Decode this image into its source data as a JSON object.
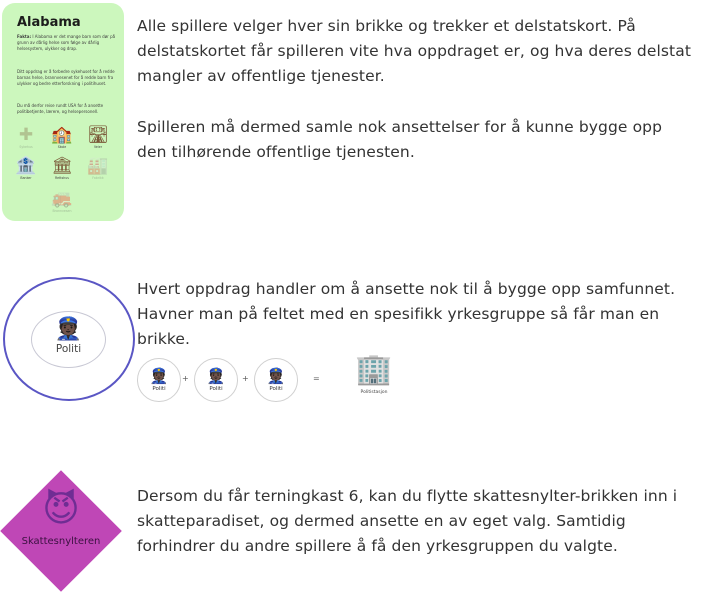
{
  "section1": {
    "card": {
      "title": "Alabama",
      "fact_label": "Fakta:",
      "fact_text": "I Alabama er det mange barn som dør på grunn av dårlig helse som følge av dårlig helsesystem, ulykker og drap.",
      "mission_text": "Ditt oppdrag er å forbedre sykehuset for å redde barnas helse, brannvesenet for å redde barn fra ulykker og bedre etterforskning i politihuset.",
      "travel_text": "Du må derfor reise rundt USA for å ansette politibetjente, lærere, og helsepersonell.",
      "services": [
        {
          "icon": "hospital-icon",
          "glyph": "✚",
          "label": "Sykehus",
          "missing": true
        },
        {
          "icon": "school-icon",
          "glyph": "🏫",
          "label": "Skole",
          "missing": false
        },
        {
          "icon": "road-icon",
          "glyph": "🛣",
          "label": "Veier",
          "missing": false
        },
        {
          "icon": "bank-icon",
          "glyph": "🏦",
          "label": "Banker",
          "missing": false
        },
        {
          "icon": "courthouse-icon",
          "glyph": "🏛",
          "label": "Rettshus",
          "missing": false
        },
        {
          "icon": "factory-icon",
          "glyph": "🏭",
          "label": "Fabrikk",
          "missing": true
        },
        {
          "icon": "fire-truck-icon",
          "glyph": "🚒",
          "label": "Brannvesen",
          "missing": true
        }
      ]
    },
    "paragraph1": "Alle spillere velger hver sin brikke og trekker et delstatskort. På delstatskortet får spilleren vite hva oppdraget er, og hva deres delstat mangler av offentlige tjenester.",
    "paragraph2": "Spilleren må dermed samle nok ansettelser for å kunne bygge opp den tilhørende offentlige tjenesten."
  },
  "section2": {
    "space_label": "Politi",
    "space_icon": "police-officer-icon",
    "space_glyph": "👮🏿",
    "paragraph": "Hvert oppdrag handler om å ansette nok til å bygge opp samfunnet. Havner man på feltet med en spesifikk yrkesgruppe så får man en brikke.",
    "token_label": "Politi",
    "plus": "+",
    "equals": "=",
    "result_label": "Politistasjon",
    "result_icon": "police-station-icon",
    "result_glyph": "🏢"
  },
  "section3": {
    "piece_label": "Skattesnylteren",
    "piece_icon": "devil-icon",
    "piece_glyph": "😈",
    "paragraph": "Dersom du får terningkast 6, kan du flytte skattesnylter-brikken inn i skatteparadiset, og dermed ansette en av eget valg. Samtidig forhindrer du andre spillere å få den yrkesgruppen du valgte."
  },
  "colors": {
    "card_bg": "#ccf7bd",
    "circle_border": "#5a56c4",
    "diamond_bg": "#bf47b6",
    "text": "#333333"
  }
}
